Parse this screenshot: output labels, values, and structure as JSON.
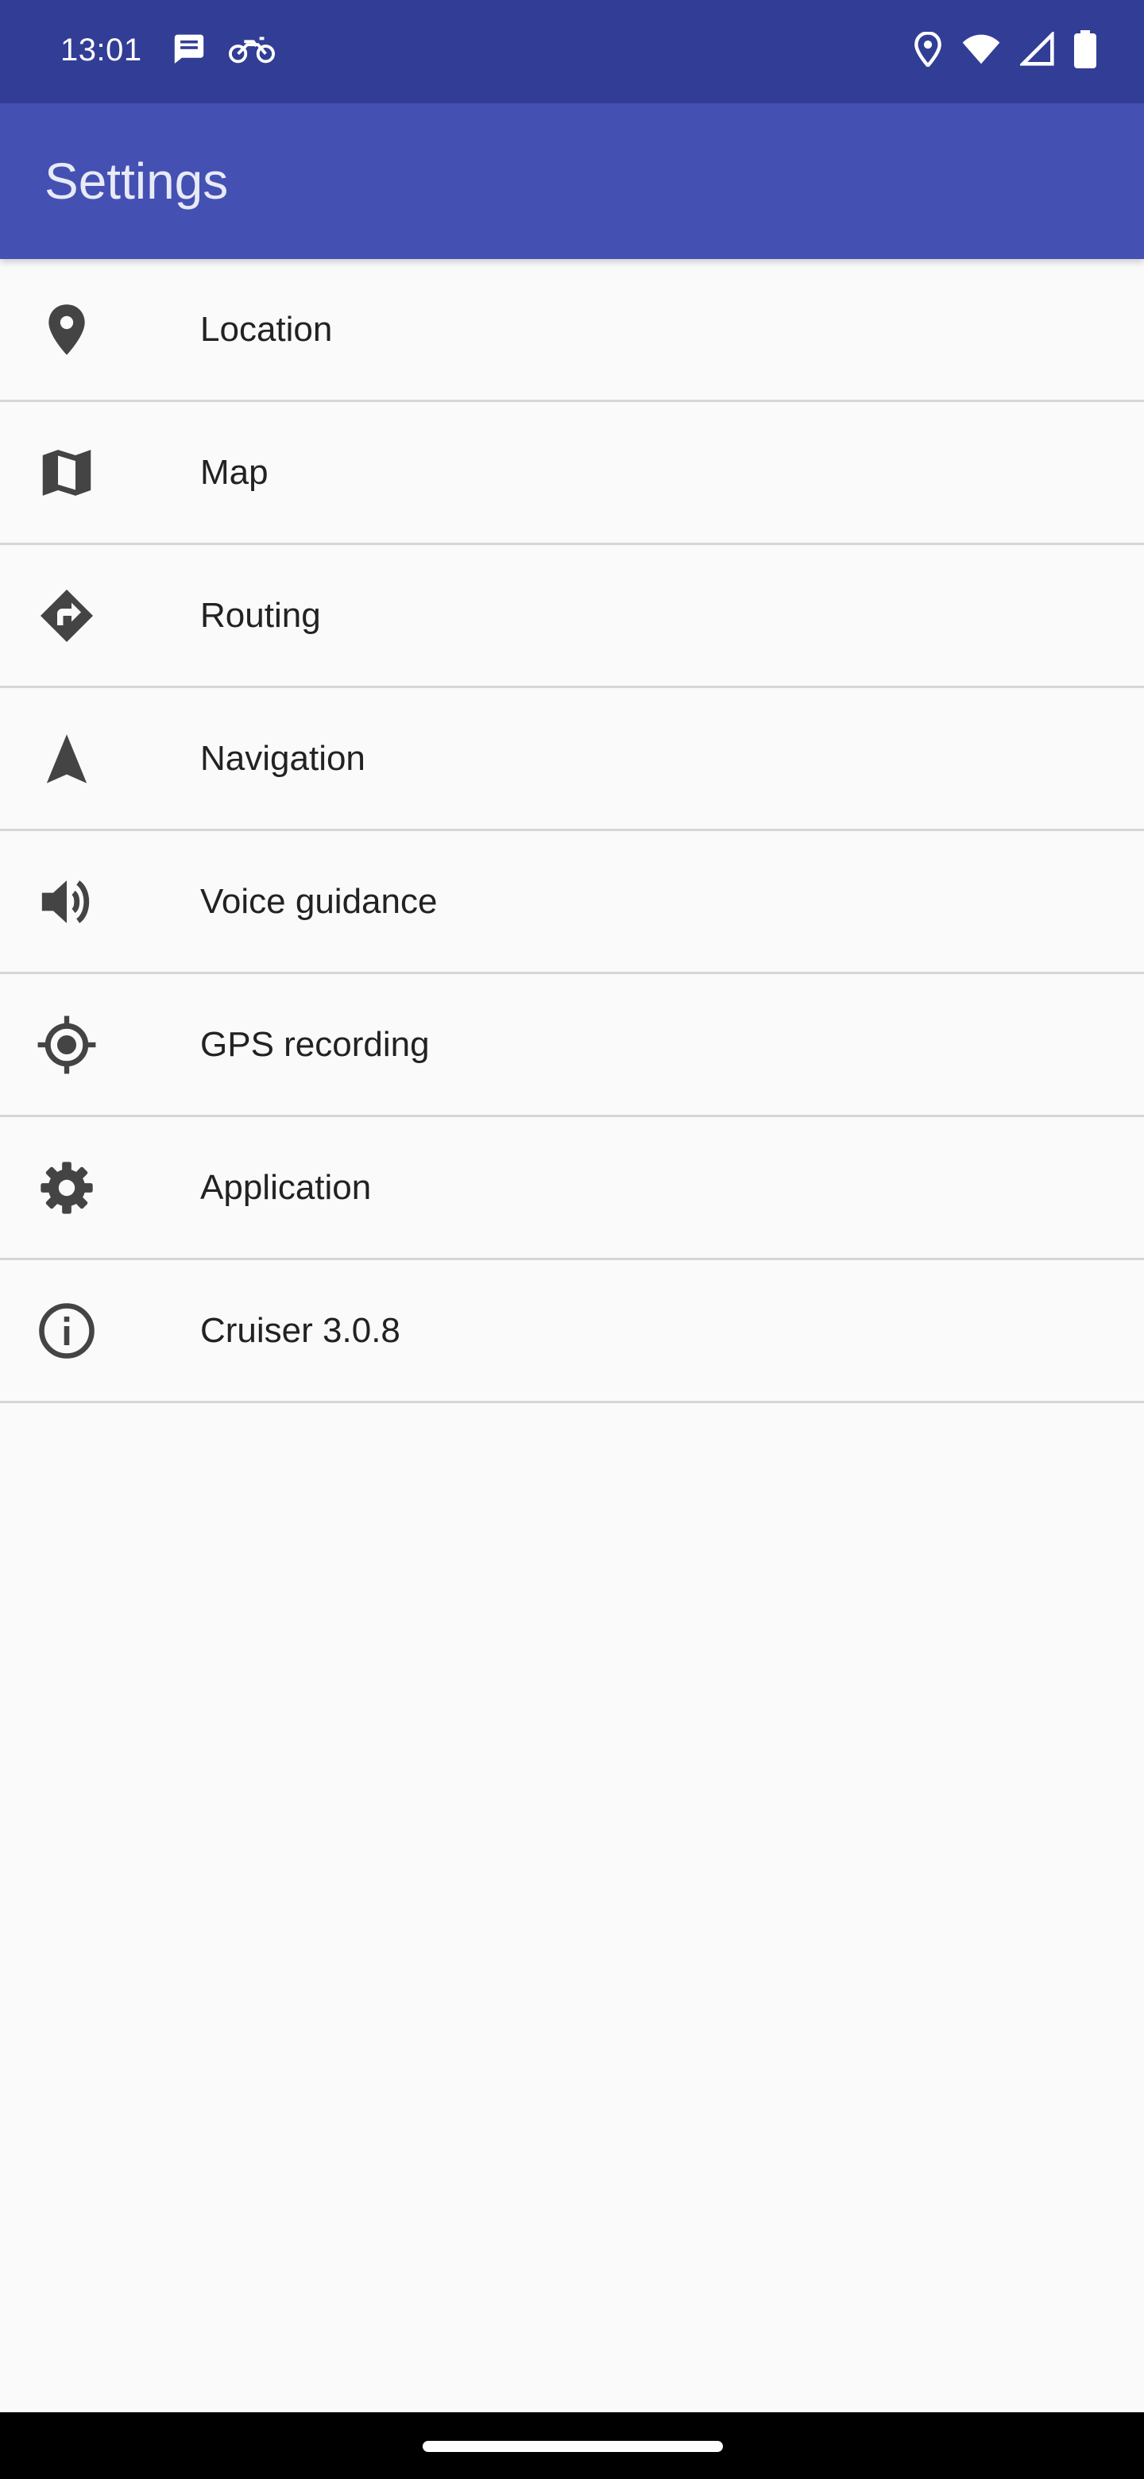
{
  "status_bar": {
    "time": "13:01",
    "background": "#323d96",
    "left_icons": [
      "message-icon",
      "motorcycle-icon"
    ],
    "right_icons": [
      "location-pin-icon",
      "wifi-icon",
      "cell-signal-icon",
      "battery-icon"
    ]
  },
  "app_bar": {
    "title": "Settings",
    "background": "#4451b3"
  },
  "settings": {
    "items": [
      {
        "label": "Location",
        "icon": "location-pin-icon"
      },
      {
        "label": "Map",
        "icon": "map-icon"
      },
      {
        "label": "Routing",
        "icon": "turn-right-icon"
      },
      {
        "label": "Navigation",
        "icon": "navigation-arrow-icon"
      },
      {
        "label": "Voice guidance",
        "icon": "volume-icon"
      },
      {
        "label": "GPS recording",
        "icon": "gps-fixed-icon"
      },
      {
        "label": "Application",
        "icon": "gear-icon"
      },
      {
        "label": "Cruiser 3.0.8",
        "icon": "info-icon"
      }
    ]
  },
  "colors": {
    "icon": "#444444",
    "text": "#222222",
    "divider": "#d6d6d6",
    "background": "#fafafa"
  }
}
